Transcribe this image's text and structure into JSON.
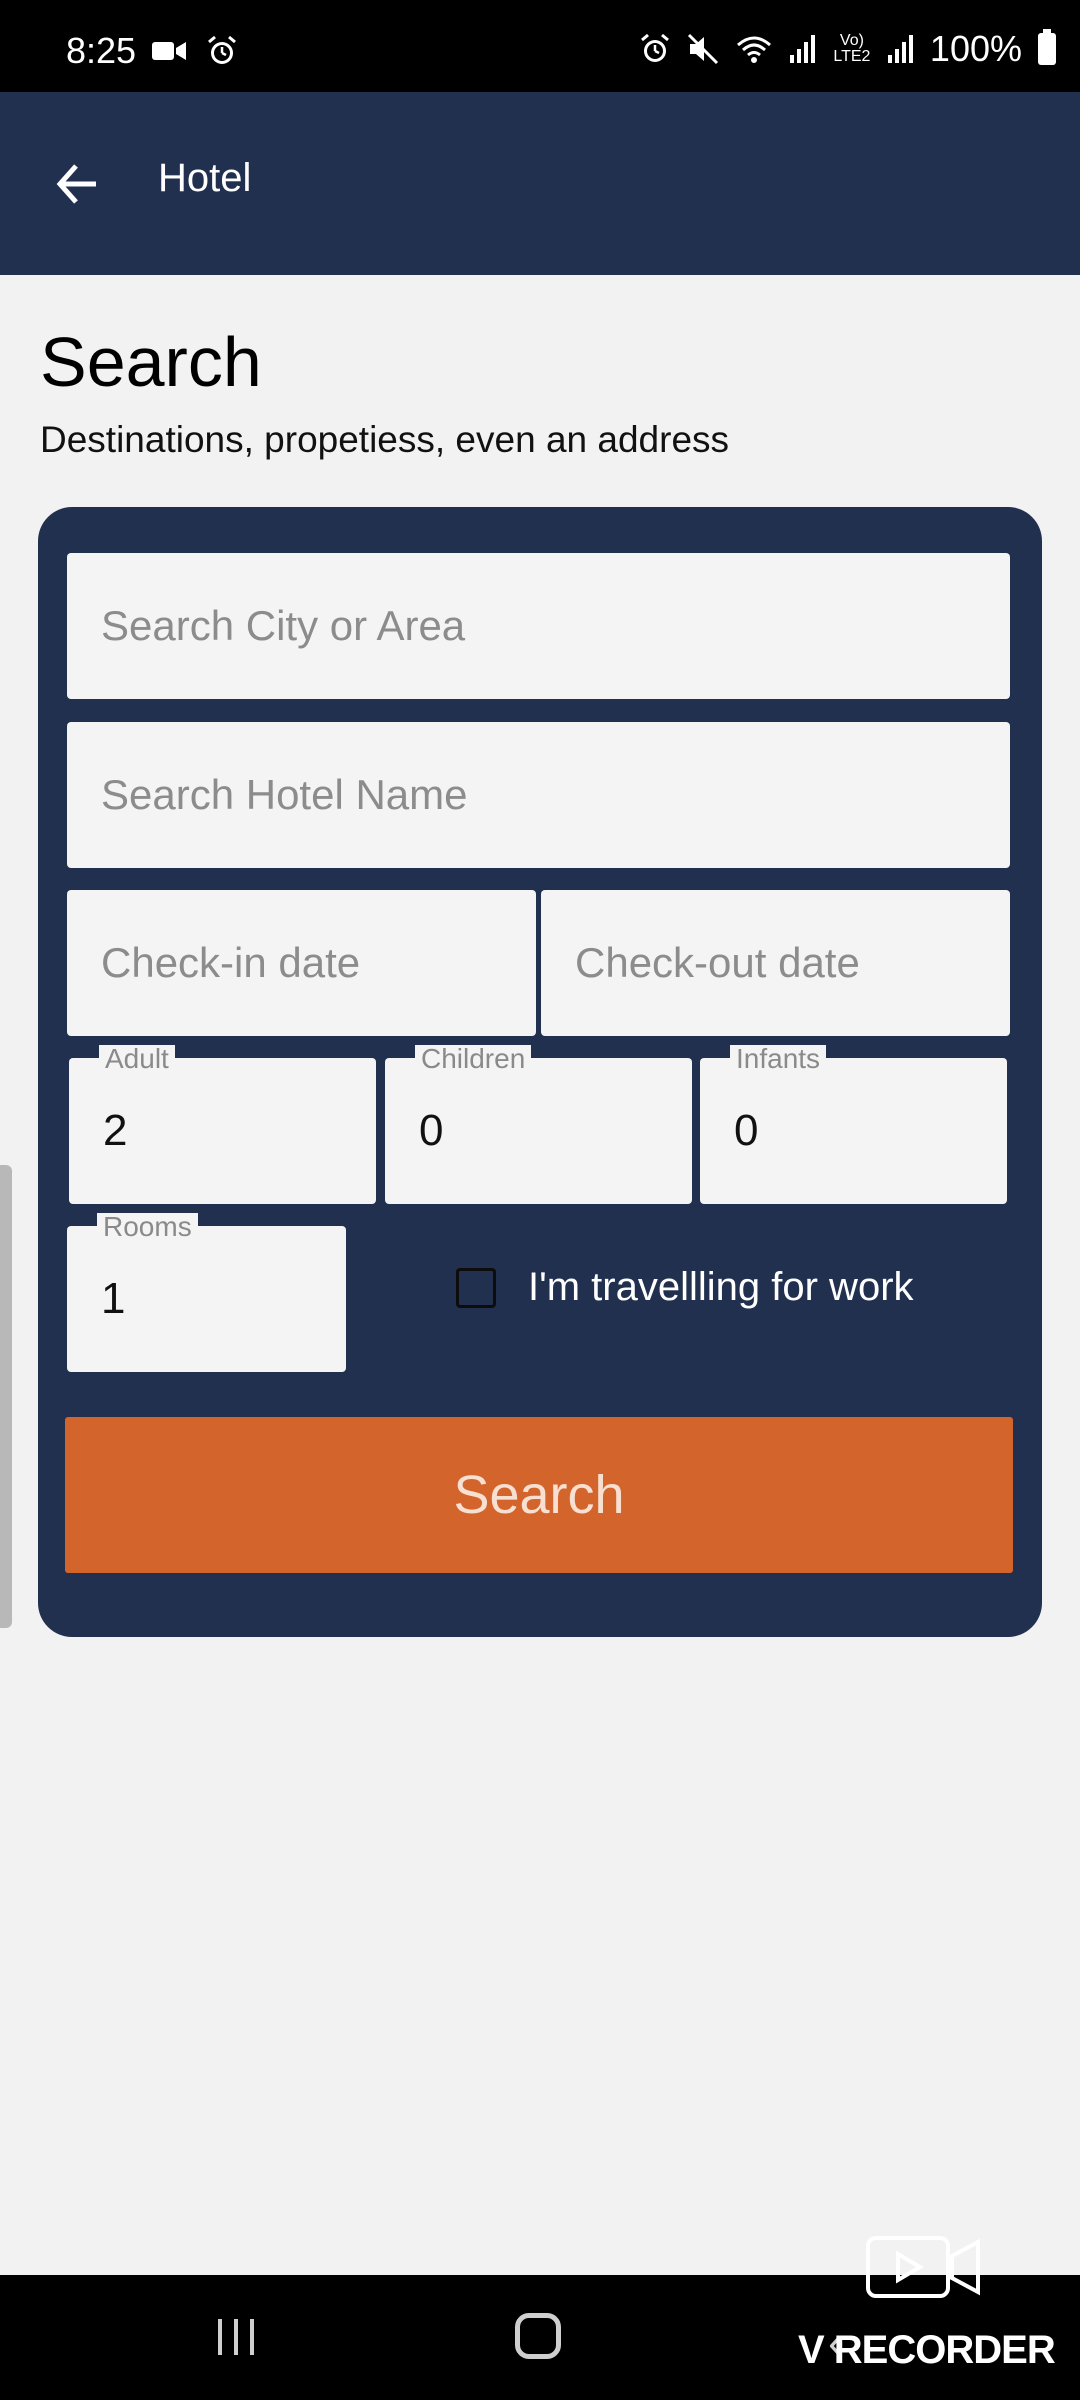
{
  "status_bar": {
    "time": "8:25",
    "left_icons": [
      "video-camera-icon",
      "alarm-icon"
    ],
    "right_icons": [
      "alarm-icon",
      "mute-icon",
      "wifi-icon",
      "signal-icon",
      "volte-icon",
      "signal-icon"
    ],
    "volte_text": "Vo) LTE2",
    "battery": "100%"
  },
  "app_bar": {
    "title": "Hotel",
    "back_icon": "arrow-left-icon",
    "color": "#223050"
  },
  "page": {
    "title": "Search",
    "subtitle": "Destinations, propetiess, even an address"
  },
  "form": {
    "city_placeholder": "Search City or Area",
    "hotel_placeholder": "Search Hotel Name",
    "checkin_placeholder": "Check-in date",
    "checkout_placeholder": "Check-out date",
    "adult": {
      "label": "Adult",
      "value": "2"
    },
    "children": {
      "label": "Children",
      "value": "0"
    },
    "infants": {
      "label": "Infants",
      "value": "0"
    },
    "rooms": {
      "label": "Rooms",
      "value": "1"
    },
    "work_travel": {
      "label": "I'm travellling for work",
      "checked": false
    },
    "search_button": "Search",
    "button_color": "#d3642c"
  },
  "nav_bar": {
    "icons": [
      "recent-apps-icon",
      "home-icon",
      "back-icon"
    ]
  },
  "watermark": {
    "text": "V RECORDER"
  }
}
